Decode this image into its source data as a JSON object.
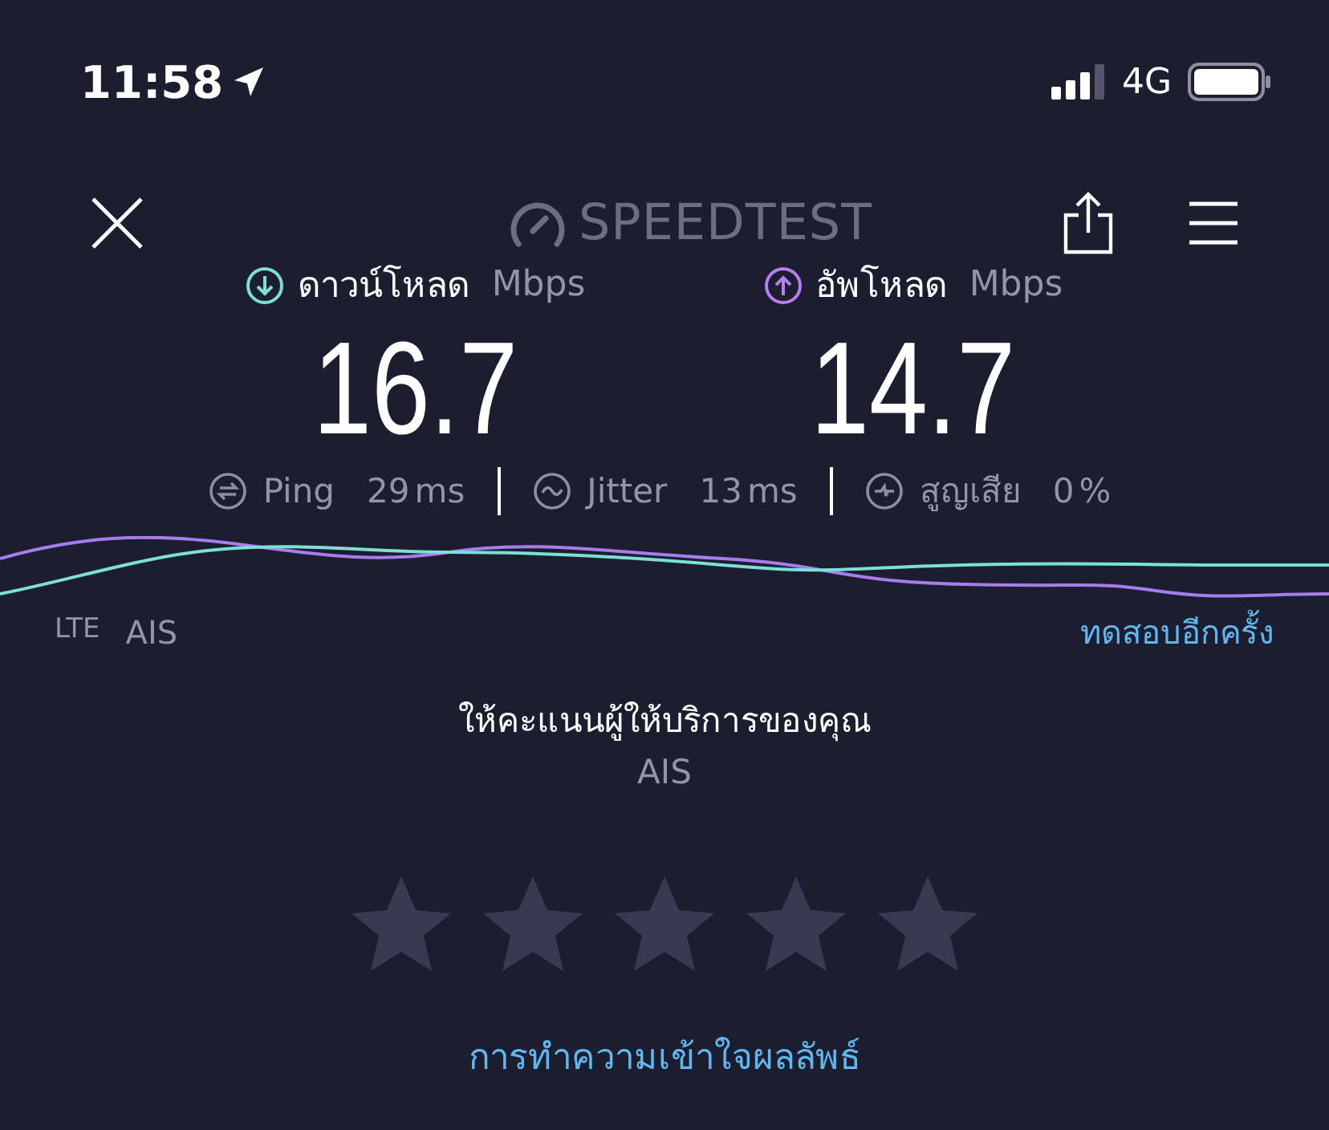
{
  "status_bar": {
    "time": "11:58",
    "network": "4G"
  },
  "header": {
    "logo": "SPEEDTEST"
  },
  "results": [
    {
      "kind": "download",
      "label": "ดาวน์โหลด",
      "unit": "Mbps",
      "value": "16.7",
      "color": "#7be0d6"
    },
    {
      "kind": "upload",
      "label": "อัพโหลด",
      "unit": "Mbps",
      "value": "14.7",
      "color": "#b57fef"
    }
  ],
  "metrics": [
    {
      "kind": "ping",
      "label": "Ping",
      "value": "29",
      "unit": "ms"
    },
    {
      "kind": "jitter",
      "label": "Jitter",
      "value": "13",
      "unit": "ms"
    },
    {
      "kind": "loss",
      "label": "สูญเสีย",
      "value": "0",
      "unit": "%"
    }
  ],
  "connection": {
    "technology": "LTE",
    "provider": "AIS",
    "retest": "ทดสอบอีกครั้ง"
  },
  "rating": {
    "prompt": "ให้คะแนนผู้ให้บริการของคุณ",
    "provider": "AIS"
  },
  "help_link": "การทำความเข้าใจผลลัพธ์"
}
